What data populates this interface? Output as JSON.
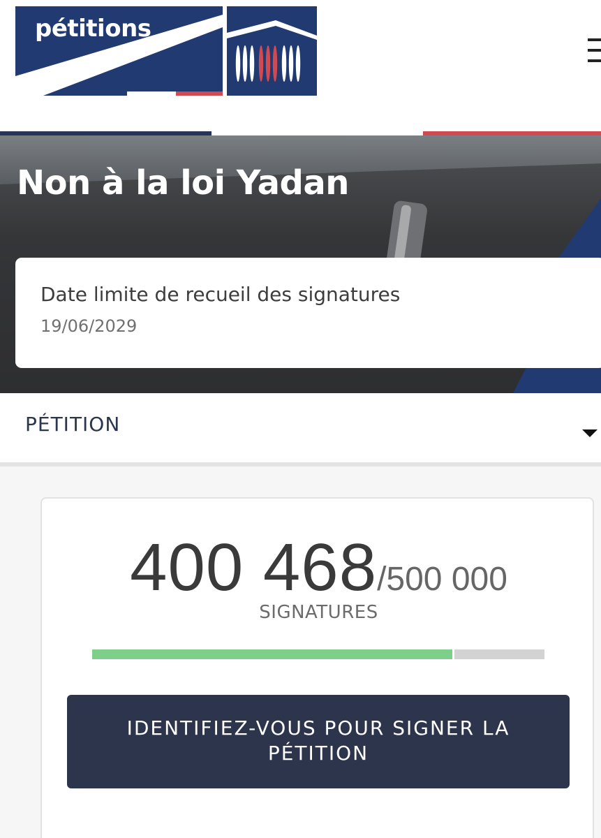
{
  "header": {
    "logo_text": "pétitions",
    "menu_icon": "hamburger-menu-icon"
  },
  "colors": {
    "navy": "#213a72",
    "red": "#d04a52",
    "button": "#2d354d",
    "progress_fill": "#7dcf8a",
    "progress_track": "#d3d3d3"
  },
  "petition": {
    "title": "Non à la loi Yadan",
    "deadline_label": "Date limite de recueil des signatures",
    "deadline_date": "19/06/2029"
  },
  "section": {
    "title": "PÉTITION",
    "toggle_icon": "triangle-down-icon"
  },
  "signatures": {
    "count": "400 468",
    "goal": "/500 000",
    "label": "SIGNATURES",
    "progress_fraction": 0.8009
  },
  "cta": {
    "label": "IDENTIFIEZ-VOUS POUR SIGNER LA PÉTITION"
  }
}
